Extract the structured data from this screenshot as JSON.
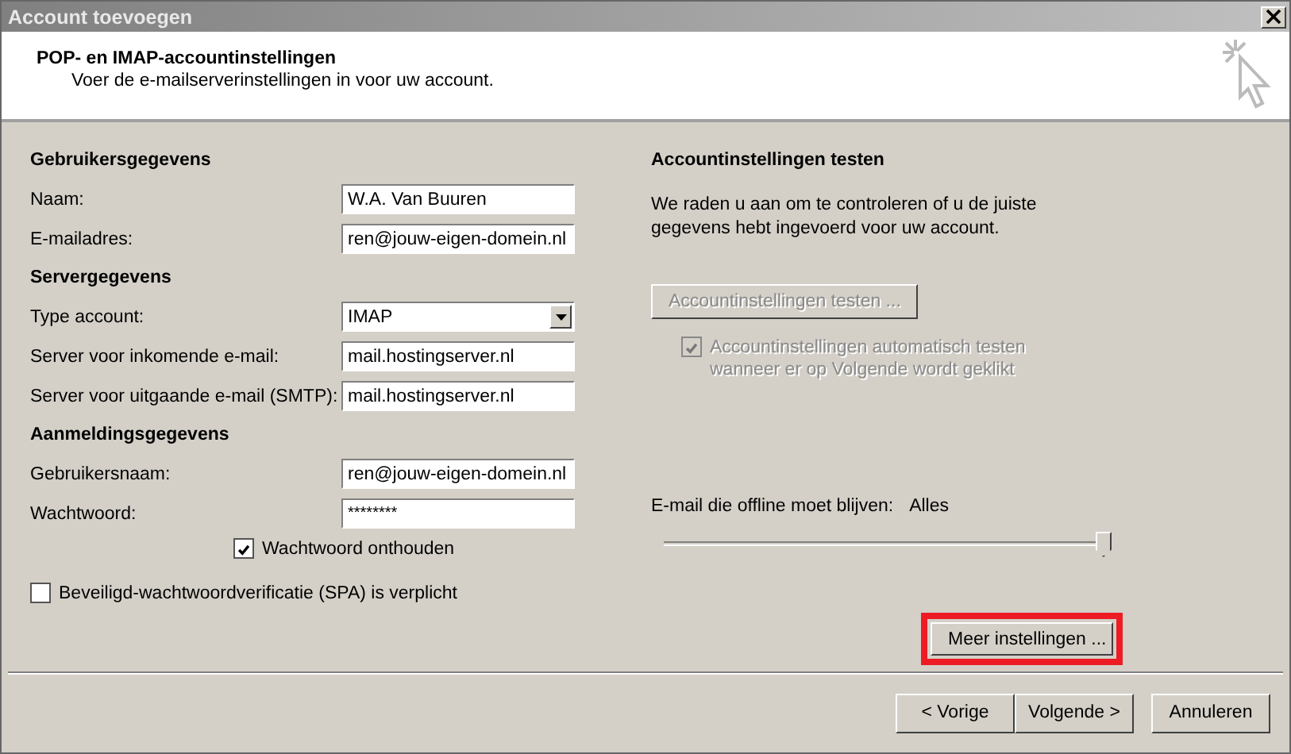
{
  "window": {
    "title": "Account toevoegen"
  },
  "header": {
    "title": "POP- en IMAP-accountinstellingen",
    "subtitle": "Voer de e-mailserverinstellingen in voor uw account."
  },
  "sections": [
    {
      "heading": "Gebruikersgegevens",
      "fields": [
        {
          "label": "Naam:",
          "kind": "text",
          "value": "W.A. Van Buuren"
        },
        {
          "label": "E-mailadres:",
          "kind": "text",
          "value": "ren@jouw-eigen-domein.nl"
        }
      ]
    },
    {
      "heading": "Servergegevens",
      "fields": [
        {
          "label": "Type account:",
          "kind": "dropdown",
          "value": "IMAP"
        },
        {
          "label": "Server voor inkomende e-mail:",
          "kind": "text",
          "value": "mail.hostingserver.nl"
        },
        {
          "label": "Server voor uitgaande e-mail (SMTP):",
          "kind": "text",
          "value": "mail.hostingserver.nl"
        }
      ]
    },
    {
      "heading": "Aanmeldingsgegevens",
      "fields": [
        {
          "label": "Gebruikersnaam:",
          "kind": "text",
          "value": "ren@jouw-eigen-domein.nl"
        },
        {
          "label": "Wachtwoord:",
          "kind": "password",
          "value": "********"
        }
      ]
    }
  ],
  "remember_password": {
    "label": "Wachtwoord onthouden",
    "checked": true
  },
  "spa": {
    "label": "Beveiligd-wachtwoordverificatie (SPA) is verplicht",
    "checked": false
  },
  "test": {
    "heading": "Accountinstellingen testen",
    "description": "We raden u aan om te controleren of u de juiste gegevens hebt ingevoerd voor uw account.",
    "button": {
      "label": "Accountinstellingen testen ...",
      "disabled": true
    },
    "auto_test": {
      "label": "Accountinstellingen automatisch testen wanneer er op Volgende wordt geklikt",
      "checked": true,
      "disabled": true
    }
  },
  "offline": {
    "label": "E-mail die offline moet blijven:",
    "value": "Alles",
    "level": 1
  },
  "more_settings": {
    "label": "Meer instellingen ...",
    "highlighted": true
  },
  "buttons": [
    {
      "label": "< Vorige"
    },
    {
      "label": "Volgende >"
    },
    {
      "label": "Annuleren"
    }
  ]
}
